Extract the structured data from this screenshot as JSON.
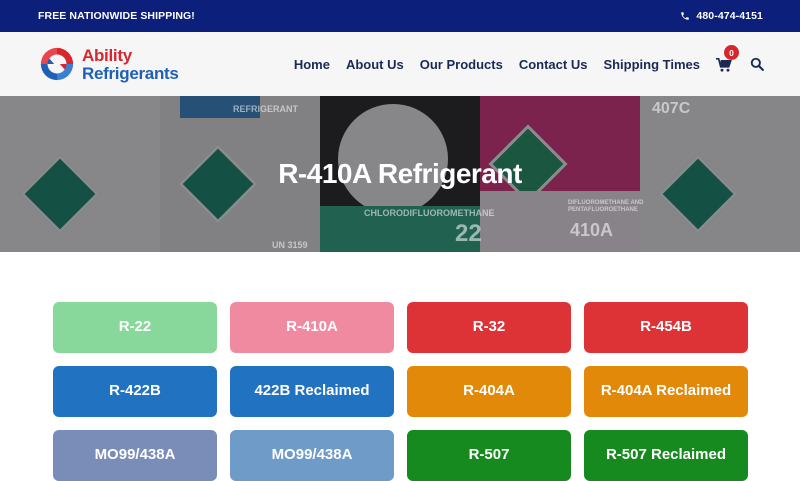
{
  "topbar": {
    "shipping": "FREE NATIONWIDE SHIPPING!",
    "phone": "480-474-4151"
  },
  "logo": {
    "line1": "Ability",
    "line2": "Refrigerants"
  },
  "nav": [
    "Home",
    "About Us",
    "Our Products",
    "Contact Us",
    "Shipping Times"
  ],
  "cart": {
    "count": "0"
  },
  "hero": {
    "title": "R-410A Refrigerant",
    "labels": [
      "REFRIGERANT",
      "UN 3159",
      "CHLORODIFLUOROMETHANE",
      "22",
      "DIFLUOROMETHANE AND PENTAFLUOROETHANE",
      "410A",
      "407C"
    ]
  },
  "products": [
    {
      "label": "R-22",
      "color": "#88d79b"
    },
    {
      "label": "R-410A",
      "color": "#f08aa0"
    },
    {
      "label": "R-32",
      "color": "#dd3236"
    },
    {
      "label": "R-454B",
      "color": "#dd3236"
    },
    {
      "label": "R-422B",
      "color": "#2172c1"
    },
    {
      "label": "422B Reclaimed",
      "color": "#2172c1"
    },
    {
      "label": "R-404A",
      "color": "#e3890a"
    },
    {
      "label": "R-404A Reclaimed",
      "color": "#e3890a"
    },
    {
      "label": "MO99/438A",
      "color": "#7a8db8"
    },
    {
      "label": "MO99/438A",
      "color": "#6f9bc9"
    },
    {
      "label": "R-507",
      "color": "#168a1e"
    },
    {
      "label": "R-507 Reclaimed",
      "color": "#168a1e"
    }
  ]
}
